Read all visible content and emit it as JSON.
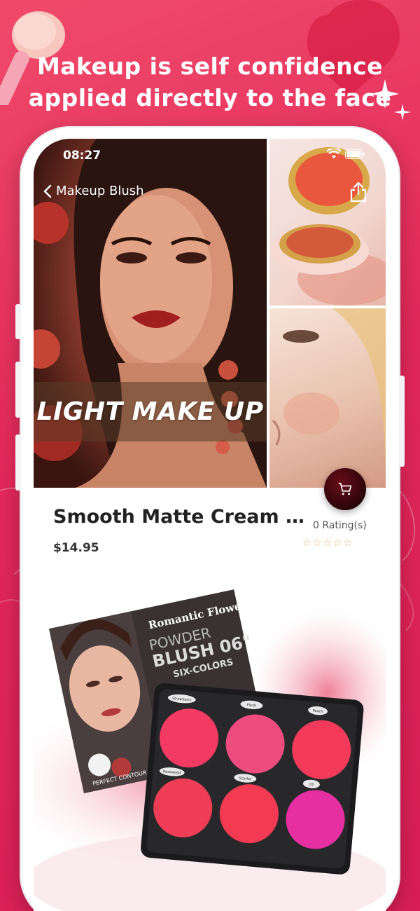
{
  "promo": {
    "headline_line1": "Makeup is self confidence",
    "headline_line2": "applied directly to the face"
  },
  "status_bar": {
    "time": "08:27"
  },
  "nav": {
    "back_label": "Makeup Blush"
  },
  "hero": {
    "banner_text": "LIGHT MAKE UP"
  },
  "product": {
    "title": "Smooth Matte Cream B...",
    "price": "$14.95",
    "rating_text": "0 Rating(s)",
    "stars": "☆☆☆☆☆",
    "rating": 0,
    "rating_max": 5
  },
  "palette_box": {
    "brand": "Romantic Flower",
    "line1": "POWDER",
    "line2": "BLUSH 06\"",
    "line3": "SIX-COLORS",
    "contour": "PERFECT CONTOUR",
    "shade_labels": [
      "Strawberry",
      "Flush",
      "Peach",
      "Rosewood",
      "Scarlet",
      "03"
    ]
  },
  "colors": {
    "background": "#e2285a",
    "accent": "#d91e55",
    "cart_button": "#2a0508",
    "star": "#e6b878"
  }
}
